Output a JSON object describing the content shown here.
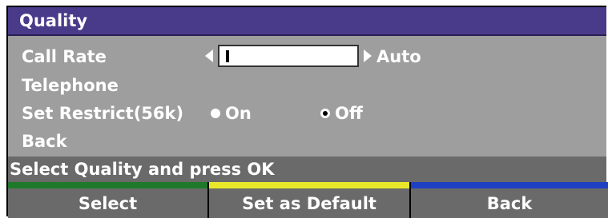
{
  "window": {
    "title": "Quality"
  },
  "rows": {
    "call_rate": {
      "label": "Call Rate",
      "input_value": "",
      "value_label": "Auto"
    },
    "telephone": {
      "label": "Telephone"
    },
    "set_restrict": {
      "label": "Set Restrict(56k)",
      "options": [
        {
          "label": "On",
          "selected": false
        },
        {
          "label": "Off",
          "selected": true
        }
      ]
    },
    "back": {
      "label": "Back"
    }
  },
  "status": {
    "text": "Select Quality and press OK"
  },
  "softkeys": [
    {
      "label": "Select",
      "color": "#1e7a2a"
    },
    {
      "label": "Set as Default",
      "color": "#e8e82a"
    },
    {
      "label": "Back",
      "color": "#1f3fc4"
    }
  ],
  "colors": {
    "title_bg": "#4a3a8a",
    "panel_bg": "#9e9e9e",
    "bar_bg": "#6a6a6a",
    "text": "#ffffff"
  }
}
